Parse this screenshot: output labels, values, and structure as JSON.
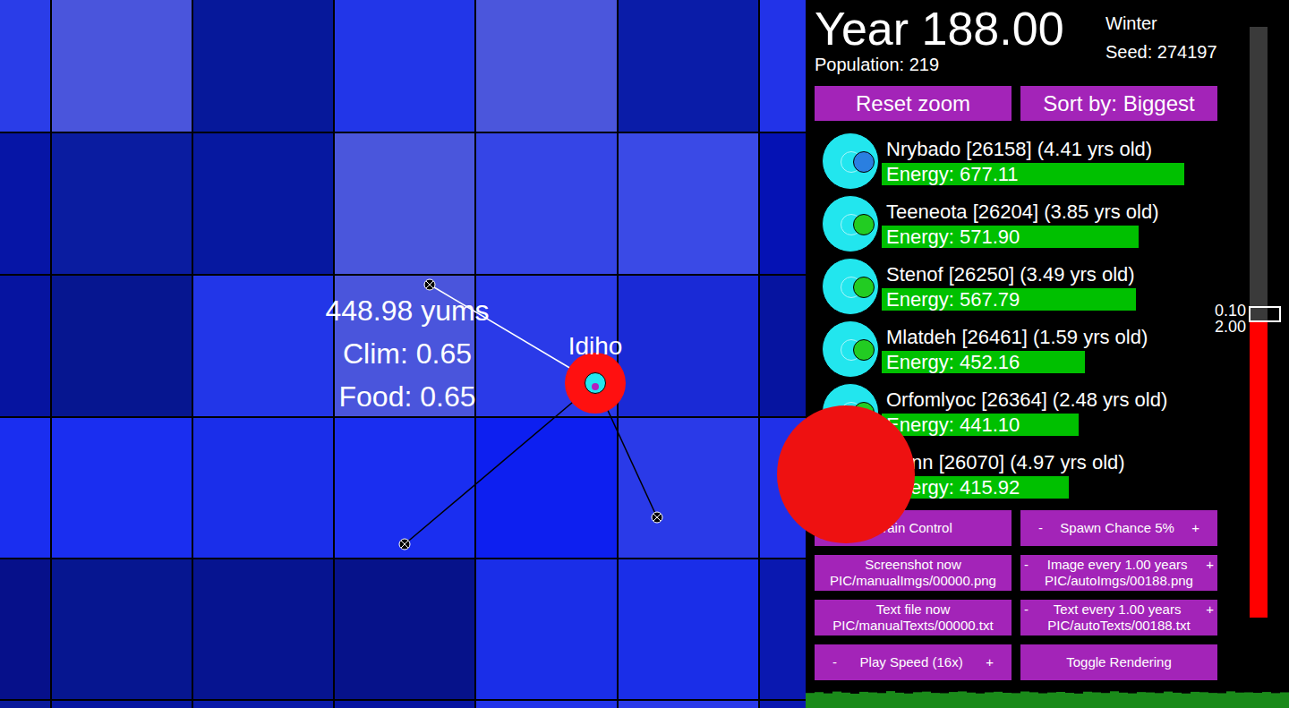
{
  "world": {
    "tiles": [
      [
        "#2a3de8",
        "#4a55dc",
        "#06189a",
        "#2236e8",
        "#4b56dc",
        "#0a1ca8",
        "#2233e8"
      ],
      [
        "#0615a6",
        "#0a1ca0",
        "#0618a0",
        "#4a56dc",
        "#3545e6",
        "#3a4ae6",
        "#0512b4"
      ],
      [
        "#0614a0",
        "#061690",
        "#2236e8",
        "#4a55dc",
        "#2a3ae8",
        "#1a2ad6",
        "#0614a0"
      ],
      [
        "#1a2ef0",
        "#1a2ef0",
        "#1a2eea",
        "#1a2ef0",
        "#0d1ff0",
        "#2a3ae8",
        "#2030e8"
      ],
      [
        "#06108a",
        "#061690",
        "#061490",
        "#06128a",
        "#1a2ee8",
        "#1a2ee8",
        "#0a18b0"
      ],
      [
        "#0a1a9a",
        "#0616a0",
        "#0a1aa8",
        "#0614a0",
        "#2233e8",
        "#2a3ae8",
        "#0a18b0"
      ]
    ],
    "creature": {
      "name": "Idiho"
    },
    "tile_info": [
      "448.98 yums",
      "Clim: 0.65",
      "Food: 0.65"
    ]
  },
  "header": {
    "year": "Year 188.00",
    "season": "Winter",
    "seed": "Seed: 274197",
    "population": "Population: 219"
  },
  "top_buttons": [
    "Reset zoom",
    "Sort by: Biggest"
  ],
  "creature_list": [
    {
      "name": "Nrybado [26158] (4.41 yrs old)",
      "energy": "Energy: 677.11",
      "level": 0.89,
      "color": "#2a7fe0"
    },
    {
      "name": "Teeneota [26204] (3.85 yrs old)",
      "energy": "Energy: 571.90",
      "level": 0.755,
      "color": "#22cc22"
    },
    {
      "name": "Stenof [26250] (3.49 yrs old)",
      "energy": "Energy: 567.79",
      "level": 0.747,
      "color": "#22cc22"
    },
    {
      "name": "Mlatdeh [26461] (1.59 yrs old)",
      "energy": "Energy: 452.16",
      "level": 0.597,
      "color": "#22cc22"
    },
    {
      "name": "Orfomlyoc [26364] (2.48 yrs old)",
      "energy": "Energy: 441.10",
      "level": 0.58,
      "color": "#22cc22"
    },
    {
      "name": "Nenn [26070] (4.97 yrs old)",
      "energy": "Energy: 415.92",
      "level": 0.55,
      "color": "#2a7fe0"
    }
  ],
  "control_buttons": [
    {
      "kind": "simple",
      "label": "Brain Control"
    },
    {
      "kind": "stepper",
      "minus": "-",
      "label": "Spawn Chance 5%",
      "plus": "+"
    },
    {
      "kind": "simple",
      "label": "Screenshot now",
      "sub": "PIC/manualImgs/00000.png"
    },
    {
      "kind": "stepper",
      "minus": "-",
      "label": "Image every 1.00 years",
      "plus": "+",
      "sub": "PIC/autoImgs/00188.png"
    },
    {
      "kind": "simple",
      "label": "Text file now",
      "sub": "PIC/manualTexts/00000.txt"
    },
    {
      "kind": "stepper",
      "minus": "-",
      "label": "Text every 1.00 years",
      "plus": "+",
      "sub": "PIC/autoTexts/00188.txt"
    },
    {
      "kind": "stepper",
      "minus": "-",
      "label": "Play Speed (16x)",
      "plus": "+"
    },
    {
      "kind": "simple",
      "label": "Toggle Rendering"
    }
  ],
  "slider": {
    "level": 0.5,
    "labels": [
      "0.10",
      "2.00"
    ]
  },
  "population_chart": {
    "values": [
      210,
      222,
      205,
      230,
      215,
      200,
      226,
      218,
      209,
      236,
      214,
      203,
      221,
      229,
      211,
      207,
      224,
      232,
      216,
      204,
      219,
      227,
      213,
      208,
      231,
      220,
      206,
      217,
      225,
      212,
      202,
      228,
      219,
      210,
      234,
      215,
      205,
      223,
      218,
      209,
      230,
      214,
      203,
      226,
      221,
      211,
      207,
      233,
      216,
      219,
      212,
      224,
      208,
      219
    ]
  }
}
